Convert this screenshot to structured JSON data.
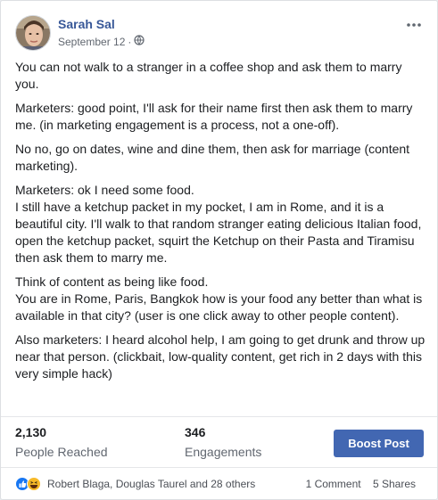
{
  "post": {
    "author": "Sarah Sal",
    "date": "September 12",
    "separator": "·",
    "paragraphs": [
      "You can not walk to a stranger in a coffee shop and ask them to marry you.",
      "Marketers: good point, I'll ask for their name first then ask them to marry me. (in marketing engagement is a process, not a one-off).",
      "No no, go on dates, wine and dine them, then ask for marriage (content marketing).",
      "Marketers: ok I need some food.\nI still have a ketchup packet in my pocket, I am in Rome, and it is a beautiful city. I'll walk to that random stranger eating delicious Italian food, open the ketchup packet, squirt the Ketchup on their Pasta and Tiramisu then ask them to marry me.",
      "Think of content as being like food.\nYou are in Rome, Paris, Bangkok how is your food any better than what is available in that city? (user is one click away to other people content).",
      "Also marketers: I heard alcohol help, I am going to get drunk and throw up near that person. (clickbait, low-quality content, get rich in 2 days with this very simple hack)"
    ]
  },
  "stats": {
    "reached_value": "2,130",
    "reached_label": "People Reached",
    "engagements_value": "346",
    "engagements_label": "Engagements",
    "boost_label": "Boost Post"
  },
  "footer": {
    "reactions_text": "Robert Blaga, Douglas Taurel and 28 others",
    "comments": "1 Comment",
    "shares": "5 Shares"
  },
  "icons": {
    "privacy": "globe-icon",
    "menu": "more-options-icon",
    "reactions": [
      "like-reaction-icon",
      "haha-reaction-icon"
    ]
  },
  "colors": {
    "author": "#385898",
    "boost": "#4267b2",
    "like": "#1877f2",
    "haha": "#f7b928"
  }
}
